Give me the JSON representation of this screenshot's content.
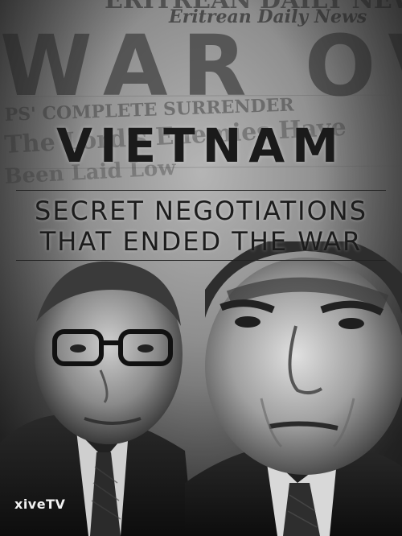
{
  "poster": {
    "title": "VIETNAM",
    "subtitle_line1": "SECRET NEGOTIATIONS",
    "subtitle_line2": "THAT ENDED THE WAR",
    "brand_logo": "xiveTV"
  },
  "background_newspaper": {
    "masthead": "Eritrean Daily News",
    "headline": "WAR OVER",
    "deck_line1": "PS' COMPLETE SURRENDER",
    "deck_line2": "The Lord's Enemies Have",
    "deck_line3": "Been Laid Low"
  },
  "colors": {
    "background": "#2b2b2b",
    "paper": "#8a8a8a",
    "title_text": "#1a1a1a",
    "logo_text": "#f2f2f2"
  }
}
